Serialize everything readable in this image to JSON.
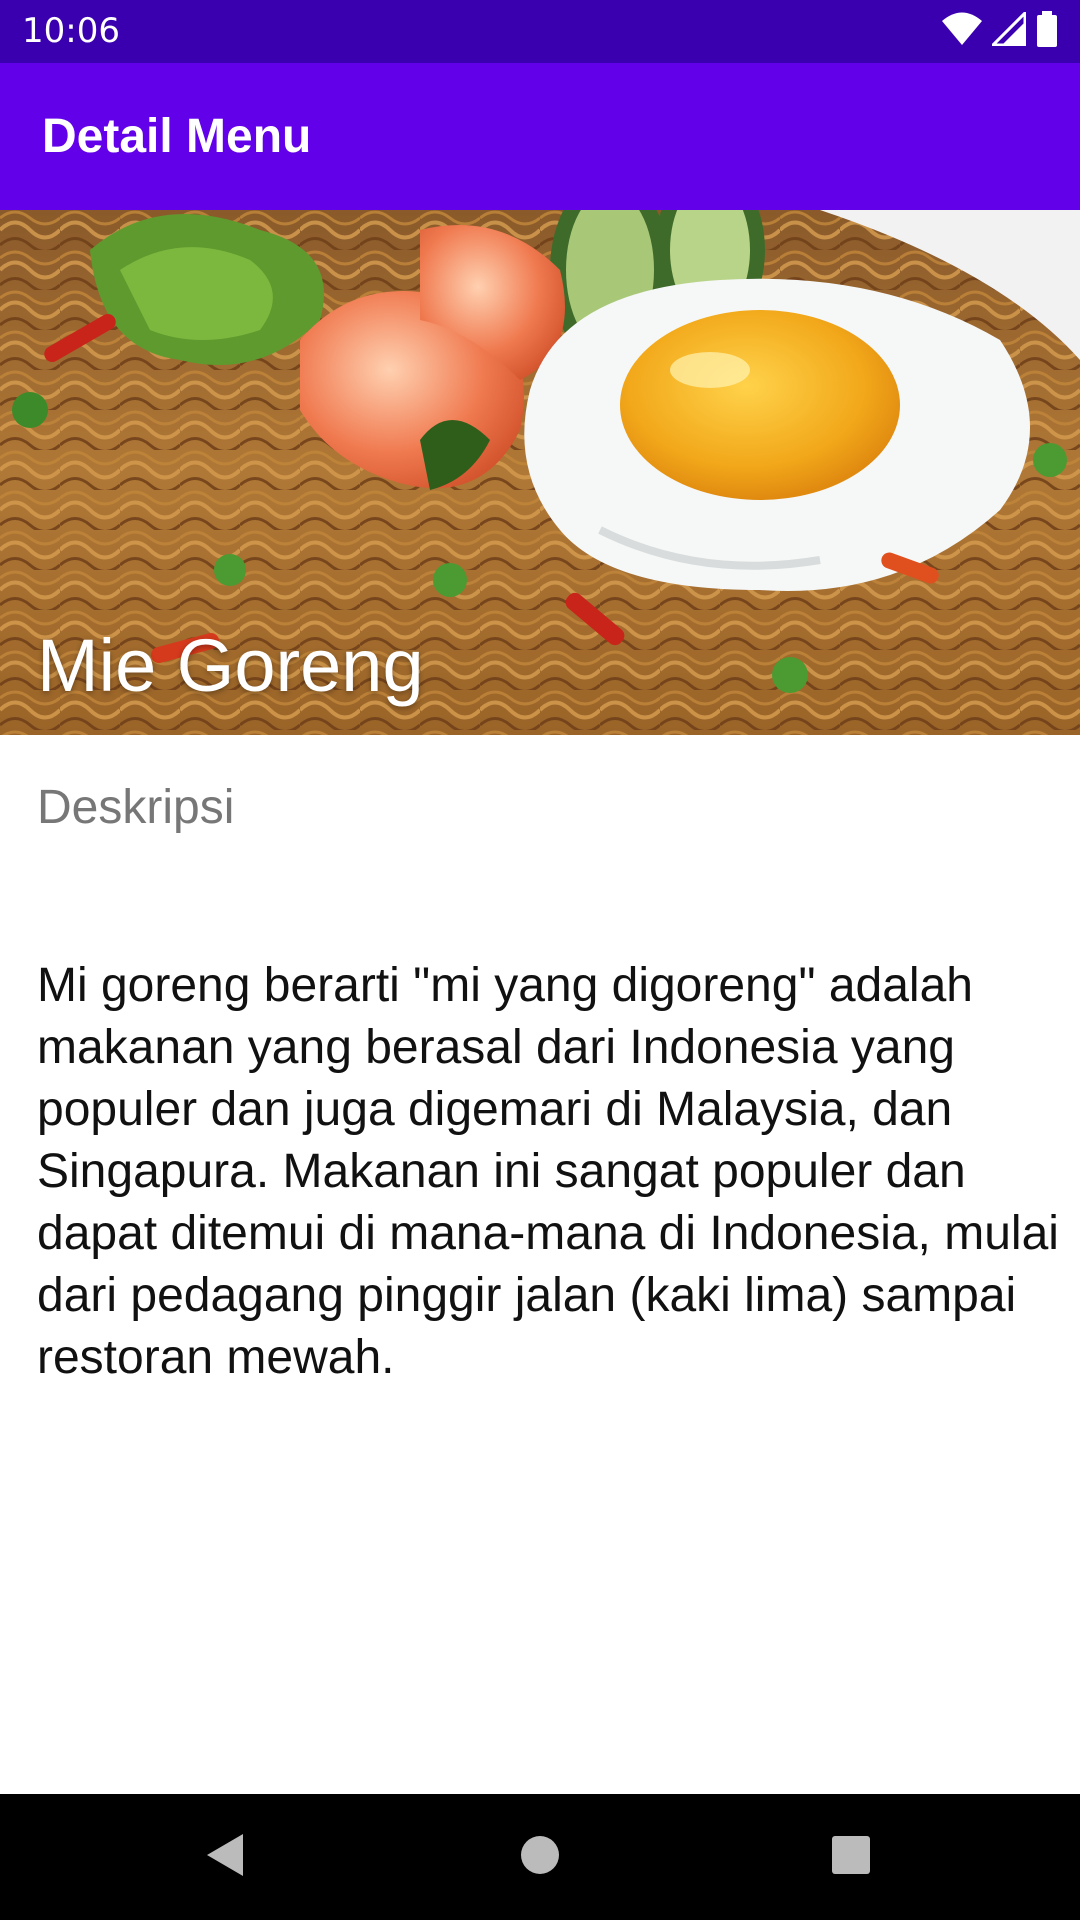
{
  "status_bar": {
    "time": "10:06",
    "icons": [
      "wifi-icon",
      "cellular-signal-icon",
      "battery-icon"
    ]
  },
  "app_bar": {
    "title": "Detail Menu",
    "color": "#6200ea"
  },
  "hero": {
    "image": "fried-noodles-with-egg-and-shrimp-photo",
    "title": "Mie Goreng"
  },
  "content": {
    "label": "Deskripsi",
    "description": "Mi goreng berarti \"mi yang digoreng\" adalah makanan yang berasal dari Indonesia yang populer dan juga digemari di Malaysia, dan Singapura. Makanan ini sangat populer dan dapat ditemui di mana-mana di Indonesia, mulai dari pedagang pinggir jalan (kaki lima) sampai restoran mewah."
  },
  "nav_bar": {
    "buttons": [
      "back-icon",
      "home-icon",
      "recents-icon"
    ]
  }
}
